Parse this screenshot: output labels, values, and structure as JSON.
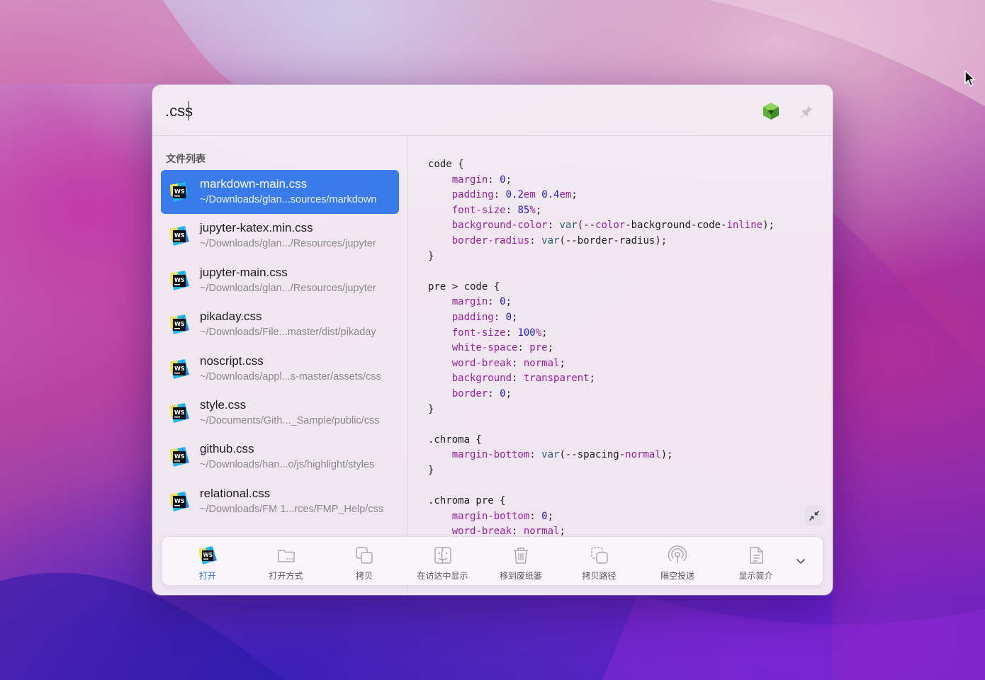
{
  "search": {
    "value": ".css",
    "placeholder": ""
  },
  "sidebar": {
    "section_label": "文件列表",
    "files": [
      {
        "name": "markdown-main.css",
        "path": "~/Downloads/glan...sources/markdown",
        "selected": true
      },
      {
        "name": "jupyter-katex.min.css",
        "path": "~/Downloads/glan.../Resources/jupyter",
        "selected": false
      },
      {
        "name": "jupyter-main.css",
        "path": "~/Downloads/glan.../Resources/jupyter",
        "selected": false
      },
      {
        "name": "pikaday.css",
        "path": "~/Downloads/File...master/dist/pikaday",
        "selected": false
      },
      {
        "name": "noscript.css",
        "path": "~/Downloads/appl...s-master/assets/css",
        "selected": false
      },
      {
        "name": "style.css",
        "path": "~/Documents/Gith..._Sample/public/css",
        "selected": false
      },
      {
        "name": "github.css",
        "path": "~/Downloads/han...o/js/highlight/styles",
        "selected": false
      },
      {
        "name": "relational.css",
        "path": "~/Downloads/FM 1...rces/FMP_Help/css",
        "selected": false
      }
    ]
  },
  "preview": {
    "code": "code {\n    margin: 0;\n    padding: 0.2em 0.4em;\n    font-size: 85%;\n    background-color: var(--color-background-code-inline);\n    border-radius: var(--border-radius);\n}\n\npre > code {\n    margin: 0;\n    padding: 0;\n    font-size: 100%;\n    white-space: pre;\n    word-break: normal;\n    background: transparent;\n    border: 0;\n}\n\n.chroma {\n    margin-bottom: var(--spacing-normal);\n}\n\n.chroma pre {\n    margin-bottom: 0;\n    word-break: normal;"
  },
  "toolbar": {
    "actions": [
      {
        "label": "打开",
        "icon": "webstorm-app-icon",
        "active": true
      },
      {
        "label": "打开方式",
        "icon": "folder-open-with-icon",
        "active": false
      },
      {
        "label": "拷贝",
        "icon": "copy-icon",
        "active": false
      },
      {
        "label": "在访达中显示",
        "icon": "finder-icon",
        "active": false
      },
      {
        "label": "移到废纸篓",
        "icon": "trash-icon",
        "active": false
      },
      {
        "label": "拷贝路径",
        "icon": "copy-path-icon",
        "active": false
      },
      {
        "label": "隔空投送",
        "icon": "airdrop-icon",
        "active": false
      },
      {
        "label": "显示简介",
        "icon": "info-document-icon",
        "active": false
      }
    ]
  },
  "colors": {
    "selection": "#3a7bec",
    "active_action": "#2f6fe0",
    "css_property": "#9a1fa0",
    "css_number": "#1c1ccc"
  }
}
